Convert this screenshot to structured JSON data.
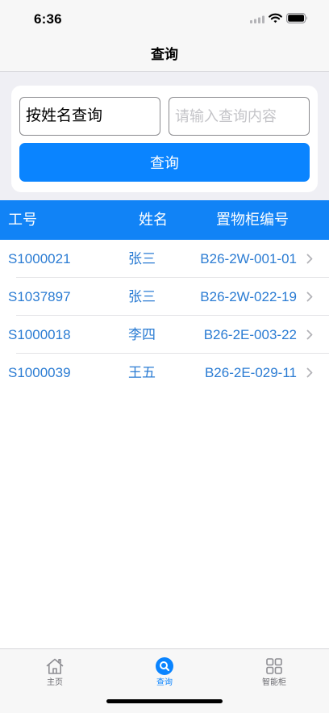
{
  "status_bar": {
    "time": "6:36",
    "icons": [
      "signal-icon",
      "wifi-icon",
      "battery-icon"
    ]
  },
  "nav": {
    "title": "查询"
  },
  "search": {
    "mode_label": "按姓名查询",
    "query_placeholder": "请输入查询内容",
    "button_label": "查询"
  },
  "table": {
    "headers": {
      "id": "工号",
      "name": "姓名",
      "locker": "置物柜编号"
    },
    "rows": [
      {
        "id": "S1000021",
        "name": "张三",
        "locker": "B26-2W-001-01"
      },
      {
        "id": "S1037897",
        "name": "张三",
        "locker": "B26-2W-022-19"
      },
      {
        "id": "S1000018",
        "name": "李四",
        "locker": "B26-2E-003-22"
      },
      {
        "id": "S1000039",
        "name": "王五",
        "locker": "B26-2E-029-11"
      }
    ]
  },
  "tab_bar": {
    "items": [
      {
        "label": "主页",
        "icon": "home-icon",
        "selected": false
      },
      {
        "label": "查询",
        "icon": "search-icon",
        "selected": true
      },
      {
        "label": "智能柜",
        "icon": "grid-icon",
        "selected": false
      }
    ]
  },
  "colors": {
    "accent": "#0a84ff",
    "header_bg": "#1183f6",
    "row_text": "#2b7cd3",
    "separator": "#e3e3e6"
  }
}
